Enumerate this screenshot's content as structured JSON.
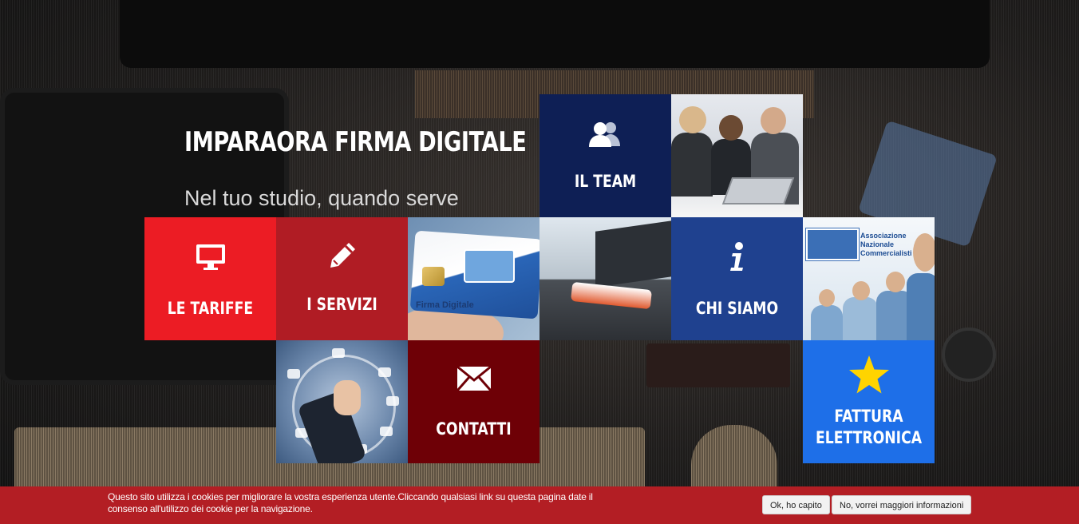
{
  "hero": {
    "title": "IMPARAORA FIRMA DIGITALE",
    "subtitle": "Nel tuo studio, quando serve"
  },
  "tiles": {
    "team": {
      "label": "IL TEAM",
      "icon": "users-icon",
      "color": "#0e1f55"
    },
    "tariffe": {
      "label": "LE TARIFFE",
      "icon": "monitor-icon",
      "color": "#ec1c24"
    },
    "servizi": {
      "label": "I SERVIZI",
      "icon": "pencil-icon",
      "color": "#b01c24"
    },
    "chi_siamo": {
      "label": "CHI SIAMO",
      "icon": "info-icon",
      "color": "#1f418f"
    },
    "contatti": {
      "label": "CONTATTI",
      "icon": "envelope-icon",
      "color": "#6e0006"
    },
    "fattura": {
      "label_line1": "FATTURA",
      "label_line2": "ELETTRONICA",
      "icon": "star-icon",
      "color": "#1e6fe8"
    }
  },
  "photos": {
    "card_text": "Firma Digitale",
    "anc_logo_text": "Associazione Nazionale Commercialisti"
  },
  "cookie": {
    "text": "Questo sito utilizza i cookies per migliorare la vostra esperienza utente.Cliccando qualsiasi link su questa pagina date il consenso all'utilizzo dei cookie per la navigazione.",
    "accept_label": "Ok, ho capito",
    "more_label": "No, vorrei maggiori informazioni"
  }
}
